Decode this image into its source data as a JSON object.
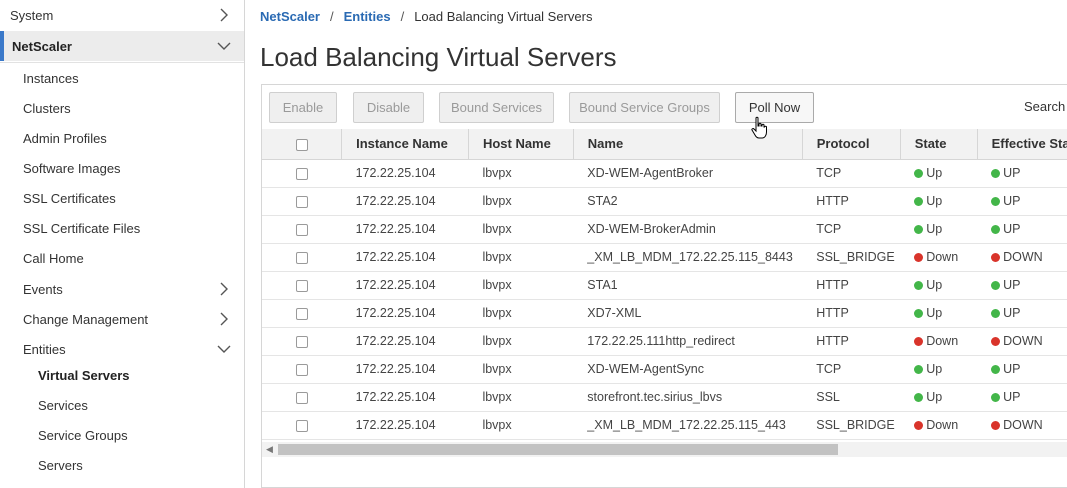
{
  "sidebar": {
    "system": "System",
    "section": "NetScaler",
    "items": [
      {
        "label": "Instances"
      },
      {
        "label": "Clusters"
      },
      {
        "label": "Admin Profiles"
      },
      {
        "label": "Software Images"
      },
      {
        "label": "SSL Certificates"
      },
      {
        "label": "SSL Certificate Files"
      },
      {
        "label": "Call Home"
      },
      {
        "label": "Events"
      },
      {
        "label": "Change Management"
      },
      {
        "label": "Entities"
      }
    ],
    "entities_children": [
      {
        "label": "Virtual Servers"
      },
      {
        "label": "Services"
      },
      {
        "label": "Service Groups"
      },
      {
        "label": "Servers"
      }
    ]
  },
  "breadcrumb": {
    "root": "NetScaler",
    "parent": "Entities",
    "current": "Load Balancing Virtual Servers"
  },
  "page": {
    "title": "Load Balancing Virtual Servers"
  },
  "toolbar": {
    "enable": "Enable",
    "disable": "Disable",
    "bound_services": "Bound Services",
    "bound_service_groups": "Bound Service Groups",
    "poll_now": "Poll Now",
    "search": "Search"
  },
  "table": {
    "headers": [
      "Instance Name",
      "Host Name",
      "Name",
      "Protocol",
      "State",
      "Effective Stat"
    ],
    "rows": [
      {
        "instance": "172.22.25.104",
        "host": "lbvpx",
        "name": "XD-WEM-AgentBroker",
        "protocol": "TCP",
        "state": "Up",
        "effective": "UP"
      },
      {
        "instance": "172.22.25.104",
        "host": "lbvpx",
        "name": "STA2",
        "protocol": "HTTP",
        "state": "Up",
        "effective": "UP"
      },
      {
        "instance": "172.22.25.104",
        "host": "lbvpx",
        "name": "XD-WEM-BrokerAdmin",
        "protocol": "TCP",
        "state": "Up",
        "effective": "UP"
      },
      {
        "instance": "172.22.25.104",
        "host": "lbvpx",
        "name": "_XM_LB_MDM_172.22.25.115_8443",
        "protocol": "SSL_BRIDGE",
        "state": "Down",
        "effective": "DOWN"
      },
      {
        "instance": "172.22.25.104",
        "host": "lbvpx",
        "name": "STA1",
        "protocol": "HTTP",
        "state": "Up",
        "effective": "UP"
      },
      {
        "instance": "172.22.25.104",
        "host": "lbvpx",
        "name": "XD7-XML",
        "protocol": "HTTP",
        "state": "Up",
        "effective": "UP"
      },
      {
        "instance": "172.22.25.104",
        "host": "lbvpx",
        "name": "172.22.25.111http_redirect",
        "protocol": "HTTP",
        "state": "Down",
        "effective": "DOWN"
      },
      {
        "instance": "172.22.25.104",
        "host": "lbvpx",
        "name": "XD-WEM-AgentSync",
        "protocol": "TCP",
        "state": "Up",
        "effective": "UP"
      },
      {
        "instance": "172.22.25.104",
        "host": "lbvpx",
        "name": "storefront.tec.sirius_lbvs",
        "protocol": "SSL",
        "state": "Up",
        "effective": "UP"
      },
      {
        "instance": "172.22.25.104",
        "host": "lbvpx",
        "name": "_XM_LB_MDM_172.22.25.115_443",
        "protocol": "SSL_BRIDGE",
        "state": "Down",
        "effective": "DOWN"
      }
    ]
  },
  "colors": {
    "up": "#43b649",
    "down": "#d9342b",
    "accent": "#3b79c9",
    "link": "#2a6ab3"
  }
}
